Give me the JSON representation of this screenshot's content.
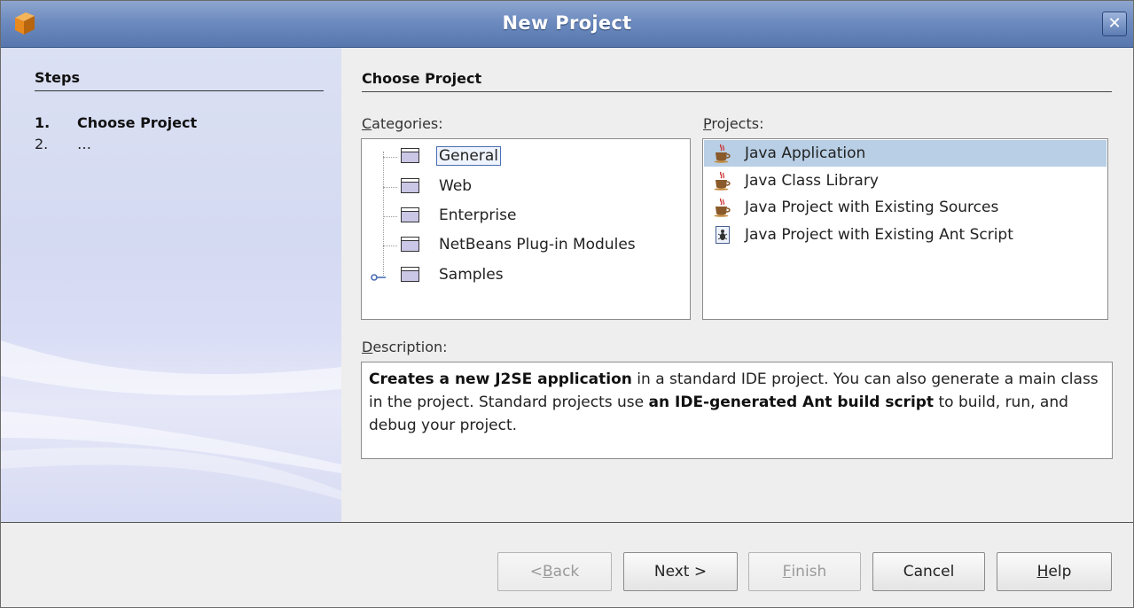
{
  "window": {
    "title": "New Project",
    "close_glyph": "✕"
  },
  "steps": {
    "title": "Steps",
    "items": [
      {
        "num": "1.",
        "label": "Choose Project",
        "active": true
      },
      {
        "num": "2.",
        "label": "…",
        "active": false
      }
    ]
  },
  "main": {
    "heading": "Choose Project",
    "categories_label_mn": "C",
    "categories_label_rest": "ategories:",
    "projects_label_mn": "P",
    "projects_label_rest": "rojects:",
    "description_label_mn": "D",
    "description_label_rest": "escription:",
    "categories": [
      {
        "label": "General",
        "selected": true
      },
      {
        "label": "Web"
      },
      {
        "label": "Enterprise"
      },
      {
        "label": "NetBeans Plug-in Modules"
      },
      {
        "label": "Samples",
        "expandable": true
      }
    ],
    "projects": [
      {
        "label": "Java Application",
        "icon": "java-cup-icon",
        "selected": true
      },
      {
        "label": "Java Class Library",
        "icon": "java-cup-icon"
      },
      {
        "label": "Java Project with Existing Sources",
        "icon": "java-cup-icon"
      },
      {
        "label": "Java Project with Existing Ant Script",
        "icon": "ant-script-icon"
      }
    ],
    "description": {
      "b1": "Creates a new J2SE application",
      "t1": " in a standard IDE project. You can also generate a main class in the project. Standard projects use ",
      "b2": "an IDE-generated Ant build script",
      "t2": " to build, run, and debug your project."
    }
  },
  "buttons": {
    "back_pre": "< ",
    "back_mn": "B",
    "back_rest": "ack",
    "next": "Next >",
    "finish_mn": "F",
    "finish_rest": "inish",
    "cancel": "Cancel",
    "help_mn": "H",
    "help_rest": "elp"
  },
  "colors": {
    "titlebar": "#6d8bbf",
    "selection": "#b8cfe5",
    "steps_bg": "#d7dcf3"
  }
}
